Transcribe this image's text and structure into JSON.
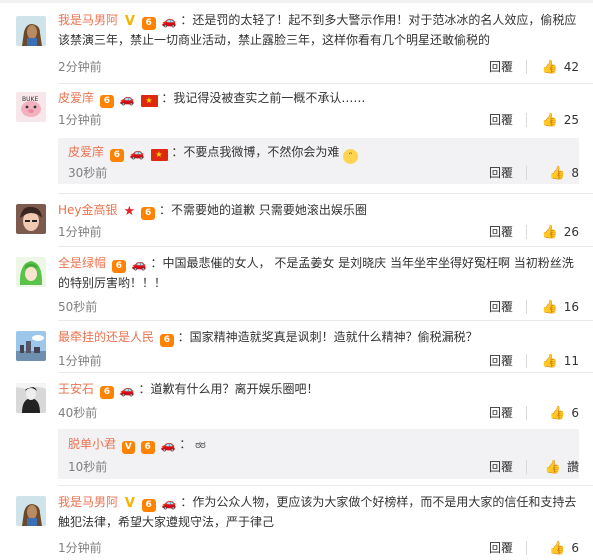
{
  "comments": [
    {
      "name": "我是马男阿",
      "text": "：还是罚的太轻了！起不到多大警示作用！对于范冰冰的名人效应，偷税应该禁演三年，禁止一切商业活动，禁止露脸三年，这样你看有几个明星还敢偷税的",
      "time": "2分钟前",
      "reply": "回覆",
      "likes": "42"
    },
    {
      "name": "皮爱庠",
      "text": "：我记得没被查实之前一概不承认……",
      "time": "1分钟前",
      "reply": "回覆",
      "likes": "25",
      "sub": {
        "name": "皮爱庠",
        "text": "：不要点我微博，不然你会为难",
        "time": "30秒前",
        "reply": "回覆",
        "likes": "8"
      }
    },
    {
      "name": "Hey金高银",
      "text": "：不需要她的道歉 只需要她滚出娱乐圈",
      "time": "1分钟前",
      "reply": "回覆",
      "likes": "26"
    },
    {
      "name": "全是绿帽",
      "text": "：中国最悲催的女人， 不是孟姜女 是刘晓庆 当年坐牢坐得好冤枉啊 当初粉丝洗的特别厉害哟！！！",
      "time": "50秒前",
      "reply": "回覆",
      "likes": "16"
    },
    {
      "name": "最牵挂的还是人民",
      "text": "：国家精神造就奖真是讽刺！造就什么精神？偷税漏税？",
      "time": "1分钟前",
      "reply": "回覆",
      "likes": "11"
    },
    {
      "name": "王安石",
      "text": "：道歉有什么用？离开娱乐圈吧！",
      "time": "40秒前",
      "reply": "回覆",
      "likes": "6",
      "sub": {
        "name": "脱单小君",
        "text": "：",
        "time": "10秒前",
        "reply": "回覆",
        "likes": "讚"
      }
    },
    {
      "name": "我是马男阿",
      "text": "：作为公众人物，更应该为大家做个好榜样，而不是用大家的信任和支持去触犯法律，希望大家遵规守法，严于律己",
      "time": "1分钟前",
      "reply": "回覆",
      "likes": "6"
    }
  ],
  "icons": {
    "thumb": "thumbs-up-icon",
    "vip": "vip-badge-icon",
    "car": "car-badge-icon",
    "flag": "china-flag-icon"
  },
  "colors": {
    "name": "#eb7350",
    "subbox": "#f2f2f5"
  }
}
